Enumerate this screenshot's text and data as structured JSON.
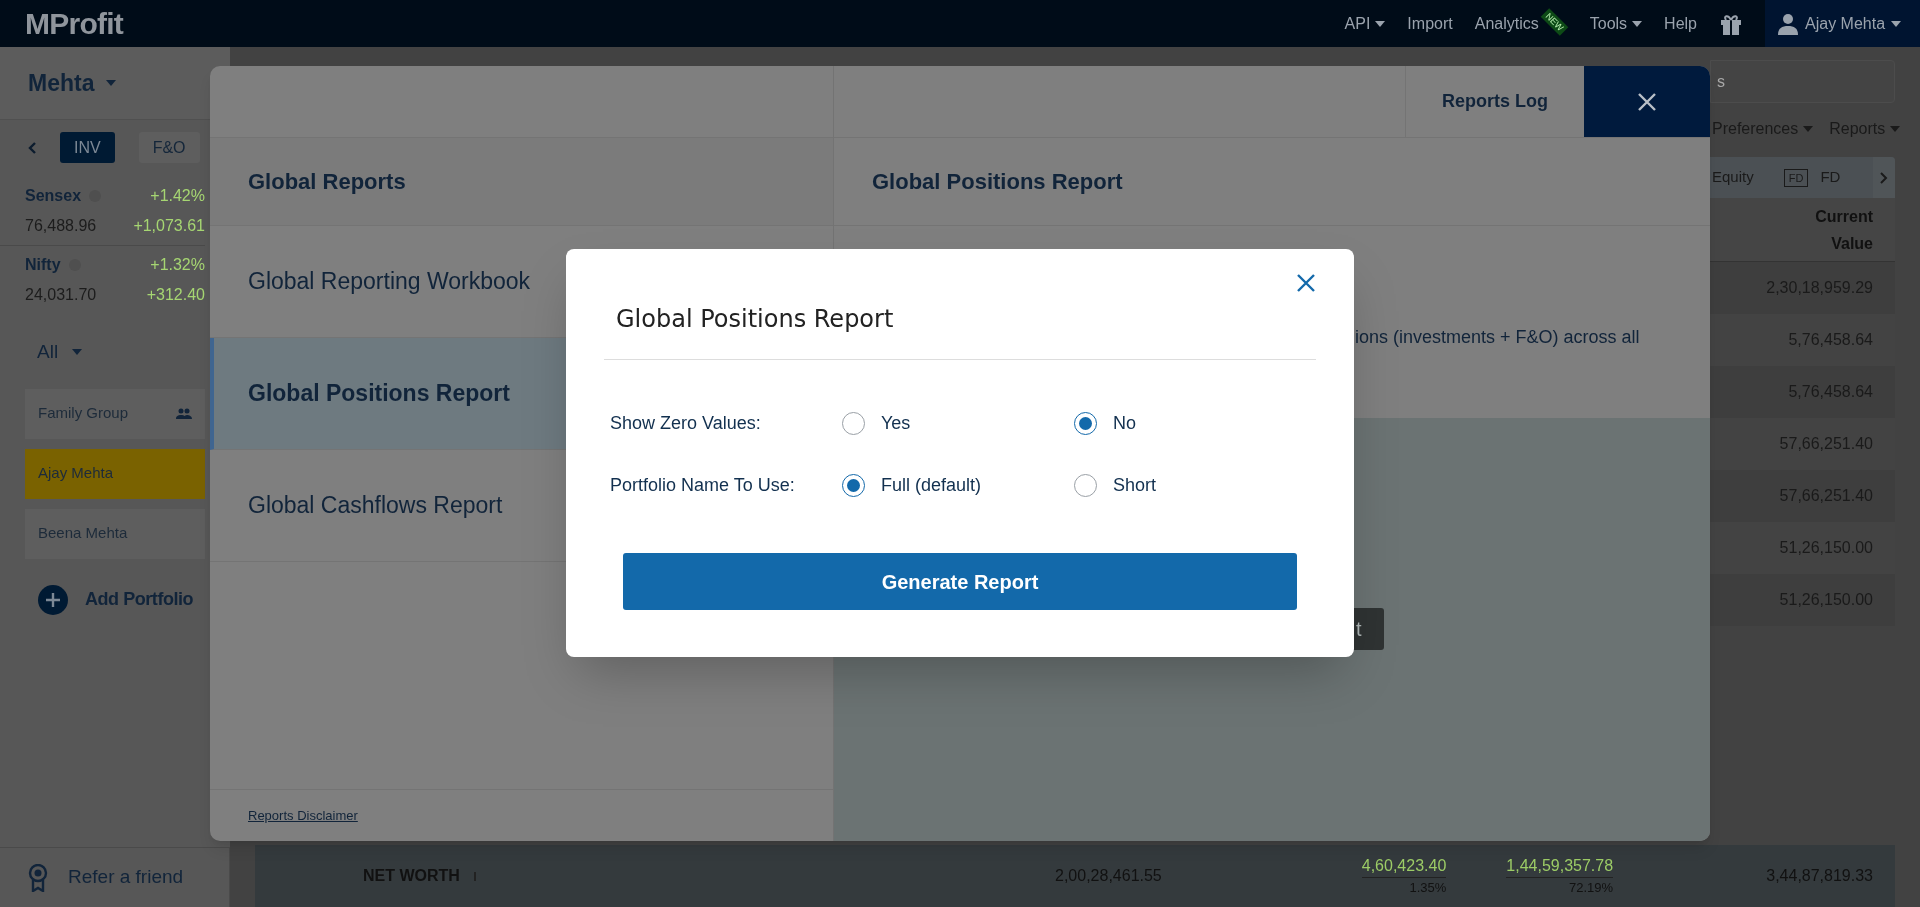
{
  "top_nav": {
    "logo": "MProfit",
    "items": [
      {
        "label": "API",
        "dropdown": true
      },
      {
        "label": "Import",
        "dropdown": false
      },
      {
        "label": "Analytics",
        "dropdown": false,
        "badge": "NEW"
      },
      {
        "label": "Tools",
        "dropdown": true
      },
      {
        "label": "Help",
        "dropdown": false
      }
    ],
    "user": "Ajay Mehta"
  },
  "sidebar": {
    "family": "Mehta",
    "tabs": [
      {
        "label": "INV",
        "selected": true
      },
      {
        "label": "F&O",
        "selected": false
      }
    ],
    "indices": [
      {
        "name": "Sensex",
        "change_pct": "+1.42%",
        "value": "76,488.96",
        "change": "+1,073.61"
      },
      {
        "name": "Nifty",
        "change_pct": "+1.32%",
        "value": "24,031.70",
        "change": "+312.40"
      }
    ],
    "filter": "All",
    "portfolios": [
      {
        "name": "Family Group",
        "kind": "group",
        "selected": false
      },
      {
        "name": "Ajay Mehta",
        "kind": "portfolio",
        "selected": true
      },
      {
        "name": "Beena Mehta",
        "kind": "portfolio",
        "selected": false
      }
    ],
    "add_portfolio": "Add Portfolio",
    "refer": "Refer a friend"
  },
  "toolbar": {
    "search_placeholder": "s",
    "menus": [
      "Preferences",
      "Reports"
    ],
    "asset_tabs": [
      {
        "label": "Equity",
        "kind": "text"
      },
      {
        "label": "FD",
        "kind": "boxed"
      },
      {
        "label": "FD",
        "kind": "text"
      }
    ]
  },
  "table": {
    "column": "Current Value",
    "rows": [
      "2,30,18,959.29",
      "5,76,458.64",
      "5,76,458.64",
      "57,66,251.40",
      "57,66,251.40",
      "51,26,150.00",
      "51,26,150.00"
    ]
  },
  "net_worth": {
    "label": "NET WORTH",
    "invested": "2,00,28,461.55",
    "gain": {
      "value": "4,60,423.40",
      "pct": "1.35%"
    },
    "total_gain": {
      "value": "1,44,59,357.78",
      "pct": "72.19%"
    },
    "current": "3,44,87,819.33"
  },
  "reports_panel": {
    "log_tab": "Reports Log",
    "left_title": "Global Reports",
    "items": [
      {
        "label": "Global Reporting Workbook",
        "selected": false
      },
      {
        "label": "Global Positions Report",
        "selected": true
      },
      {
        "label": "Global Cashflows Report",
        "selected": false
      }
    ],
    "disclaimer": "Reports Disclaimer",
    "right_title": "Global Positions Report",
    "description": "ions (investments + F&O) across all",
    "button_fragment": "t"
  },
  "modal": {
    "title": "Global Positions Report",
    "options": [
      {
        "label": "Show Zero Values:",
        "choices": [
          {
            "label": "Yes",
            "selected": false
          },
          {
            "label": "No",
            "selected": true
          }
        ]
      },
      {
        "label": "Portfolio Name To Use:",
        "choices": [
          {
            "label": "Full (default)",
            "selected": true
          },
          {
            "label": "Short",
            "selected": false
          }
        ]
      }
    ],
    "button": "Generate Report"
  }
}
